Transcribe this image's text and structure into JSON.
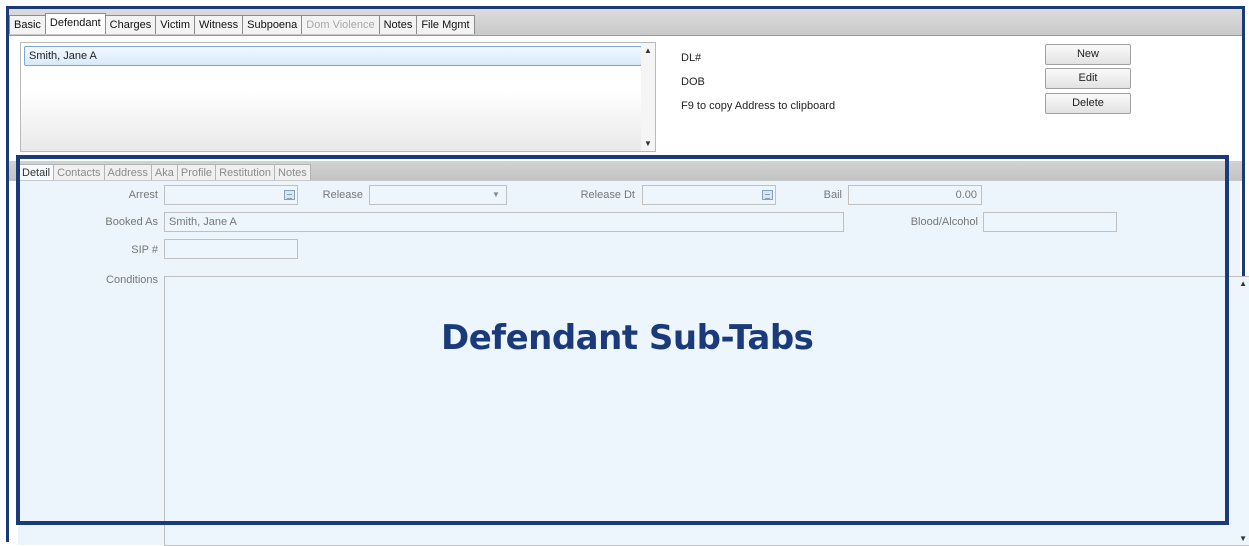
{
  "top_tabs": [
    {
      "label": "Basic",
      "state": "normal"
    },
    {
      "label": "Defendant",
      "state": "active"
    },
    {
      "label": "Charges",
      "state": "normal"
    },
    {
      "label": "Victim",
      "state": "normal"
    },
    {
      "label": "Witness",
      "state": "normal"
    },
    {
      "label": "Subpoena",
      "state": "normal"
    },
    {
      "label": "Dom Violence",
      "state": "disabled"
    },
    {
      "label": "Notes",
      "state": "normal"
    },
    {
      "label": "File Mgmt",
      "state": "normal"
    }
  ],
  "defendant_list": {
    "items": [
      "Smith, Jane A"
    ],
    "selected": "Smith, Jane A"
  },
  "defendant_info": {
    "dl_label": "DL#",
    "dob_label": "DOB",
    "hint": "F9 to copy Address to clipboard"
  },
  "buttons": {
    "new": "New",
    "edit": "Edit",
    "delete": "Delete"
  },
  "sub_tabs": [
    {
      "label": "Detail",
      "state": "active"
    },
    {
      "label": "Contacts",
      "state": "normal"
    },
    {
      "label": "Address",
      "state": "normal"
    },
    {
      "label": "Aka",
      "state": "normal"
    },
    {
      "label": "Profile",
      "state": "normal"
    },
    {
      "label": "Restitution",
      "state": "normal"
    },
    {
      "label": "Notes",
      "state": "normal"
    }
  ],
  "detail": {
    "arrest_label": "Arrest",
    "arrest_value": "",
    "release_label": "Release",
    "release_value": "",
    "release_dt_label": "Release Dt",
    "release_dt_value": "",
    "bail_label": "Bail",
    "bail_value": "0.00",
    "booked_as_label": "Booked As",
    "booked_as_value": "Smith, Jane A",
    "blood_alcohol_label": "Blood/Alcohol",
    "blood_alcohol_value": "",
    "sip_label": "SIP #",
    "sip_value": "",
    "conditions_label": "Conditions",
    "conditions_value": ""
  },
  "annotation": {
    "text": "Defendant Sub-Tabs",
    "color": "#1a3a7a"
  },
  "colors": {
    "frame_border": "#1a3a7a",
    "panel_bg": "#ebf5fb",
    "selection_border": "#7aa7d8"
  },
  "icons": {
    "calendar": "calendar-icon",
    "dropdown": "chevron-down-icon",
    "scroll_up": "scroll-up-arrow-icon",
    "scroll_down": "scroll-down-arrow-icon"
  }
}
